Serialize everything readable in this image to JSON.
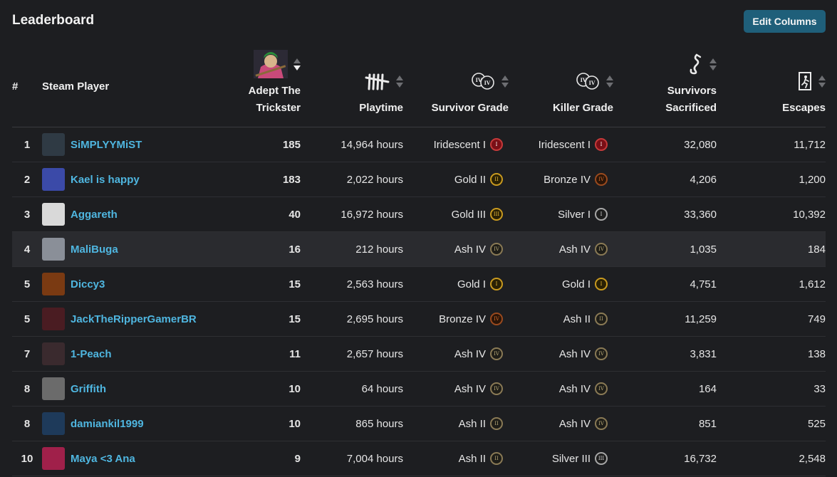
{
  "header": {
    "title": "Leaderboard",
    "edit_button": "Edit Columns"
  },
  "columns": {
    "rank": "#",
    "player": "Steam Player",
    "adept_line1": "Adept The",
    "adept_line2": "Trickster",
    "playtime": "Playtime",
    "survivor_grade": "Survivor Grade",
    "killer_grade": "Killer Grade",
    "sacrificed_line1": "Survivors",
    "sacrificed_line2": "Sacrificed",
    "escapes": "Escapes"
  },
  "icons": {
    "adept": "trickster-portrait-icon",
    "playtime": "tally-marks-icon",
    "survivor_grade": "survivor-grade-icon",
    "killer_grade": "killer-grade-icon",
    "sacrificed": "hook-icon",
    "escapes": "exit-door-icon"
  },
  "colors": {
    "accent": "#4fb6e0",
    "button": "#1f5f7a",
    "background": "#1d1e21"
  },
  "rows": [
    {
      "rank": "1",
      "name": "SiMPLYYMiST",
      "adept": "185",
      "playtime": "14,964 hours",
      "survivor": "Iridescent I",
      "survivor_tier": "iri",
      "survivor_num": "I",
      "killer": "Iridescent I",
      "killer_tier": "iri",
      "killer_num": "I",
      "sacrificed": "32,080",
      "escapes": "11,712",
      "avatar": "#2f3a44"
    },
    {
      "rank": "2",
      "name": "Kael is happy",
      "adept": "183",
      "playtime": "2,022 hours",
      "survivor": "Gold II",
      "survivor_tier": "gold",
      "survivor_num": "II",
      "killer": "Bronze IV",
      "killer_tier": "bronze",
      "killer_num": "IV",
      "sacrificed": "4,206",
      "escapes": "1,200",
      "avatar": "#3b4aa8"
    },
    {
      "rank": "3",
      "name": "Aggareth",
      "adept": "40",
      "playtime": "16,972 hours",
      "survivor": "Gold III",
      "survivor_tier": "gold",
      "survivor_num": "III",
      "killer": "Silver I",
      "killer_tier": "silver",
      "killer_num": "I",
      "sacrificed": "33,360",
      "escapes": "10,392",
      "avatar": "#d9d9d9"
    },
    {
      "rank": "4",
      "name": "MaliBuga",
      "adept": "16",
      "playtime": "212 hours",
      "survivor": "Ash IV",
      "survivor_tier": "ash",
      "survivor_num": "IV",
      "killer": "Ash IV",
      "killer_tier": "ash",
      "killer_num": "IV",
      "sacrificed": "1,035",
      "escapes": "184",
      "avatar": "#8a8f98"
    },
    {
      "rank": "5",
      "name": "Diccy3",
      "adept": "15",
      "playtime": "2,563 hours",
      "survivor": "Gold I",
      "survivor_tier": "gold",
      "survivor_num": "I",
      "killer": "Gold I",
      "killer_tier": "gold",
      "killer_num": "I",
      "sacrificed": "4,751",
      "escapes": "1,612",
      "avatar": "#7a3a12"
    },
    {
      "rank": "5",
      "name": "JackTheRipperGamerBR",
      "adept": "15",
      "playtime": "2,695 hours",
      "survivor": "Bronze IV",
      "survivor_tier": "bronze",
      "survivor_num": "IV",
      "killer": "Ash II",
      "killer_tier": "ash",
      "killer_num": "II",
      "sacrificed": "11,259",
      "escapes": "749",
      "avatar": "#4a1c22"
    },
    {
      "rank": "7",
      "name": "1-Peach",
      "adept": "11",
      "playtime": "2,657 hours",
      "survivor": "Ash IV",
      "survivor_tier": "ash",
      "survivor_num": "IV",
      "killer": "Ash IV",
      "killer_tier": "ash",
      "killer_num": "IV",
      "sacrificed": "3,831",
      "escapes": "138",
      "avatar": "#3a2a2e"
    },
    {
      "rank": "8",
      "name": "Griffith",
      "adept": "10",
      "playtime": "64 hours",
      "survivor": "Ash IV",
      "survivor_tier": "ash",
      "survivor_num": "IV",
      "killer": "Ash IV",
      "killer_tier": "ash",
      "killer_num": "IV",
      "sacrificed": "164",
      "escapes": "33",
      "avatar": "#6b6b6b"
    },
    {
      "rank": "8",
      "name": "damiankil1999",
      "adept": "10",
      "playtime": "865 hours",
      "survivor": "Ash II",
      "survivor_tier": "ash",
      "survivor_num": "II",
      "killer": "Ash IV",
      "killer_tier": "ash",
      "killer_num": "IV",
      "sacrificed": "851",
      "escapes": "525",
      "avatar": "#1e3a5a"
    },
    {
      "rank": "10",
      "name": "Maya <3 Ana",
      "adept": "9",
      "playtime": "7,004 hours",
      "survivor": "Ash II",
      "survivor_tier": "ash",
      "survivor_num": "II",
      "killer": "Silver III",
      "killer_tier": "silver",
      "killer_num": "III",
      "sacrificed": "16,732",
      "escapes": "2,548",
      "avatar": "#a0204a"
    }
  ],
  "highlighted_row_index": 3
}
